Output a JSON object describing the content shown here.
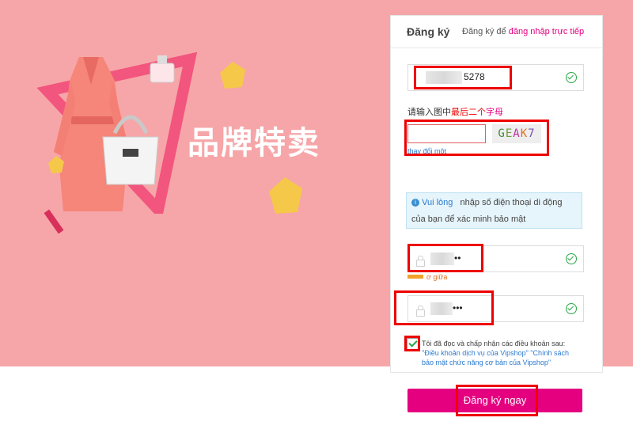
{
  "banner": {
    "brand_text": "品牌特卖"
  },
  "tabs": {
    "active_label": "Đăng ký",
    "hint_prefix": "Đăng ký để",
    "hint_link": "đăng nhập trực tiếp"
  },
  "phone_field": {
    "value_suffix": "5278"
  },
  "captcha": {
    "instruction_prefix": "请输入图中",
    "instruction_emph1": "最后二个",
    "instruction_emph2": "字母",
    "code_chars": [
      "G",
      "E",
      "A",
      "K",
      "7"
    ],
    "refresh_link": "thay đổi một"
  },
  "notice": {
    "line1_prefix": "Vui lòng",
    "line1_rest": "nhập số điện thoại di động",
    "line2": "của bạn để xác minh bảo mật"
  },
  "password_field": {
    "masked": "••",
    "strength_label": "ơ giữa"
  },
  "confirm_field": {
    "masked": "•••"
  },
  "terms": {
    "text": "Tôi đã đọc và chấp nhận các điều khoản sau:",
    "link1": "\"Điều khoản dịch vụ của Vipshop\"",
    "link2": "\"Chính sách",
    "link3": "bảo mật chức năng cơ bản của Vipshop\"",
    "checked": true
  },
  "submit": {
    "label": "Đăng ký ngay"
  },
  "colors": {
    "accent": "#e4007f",
    "banner_bg": "#f6a6a8",
    "annotation_red": "#e00000",
    "success_green": "#27a844"
  }
}
